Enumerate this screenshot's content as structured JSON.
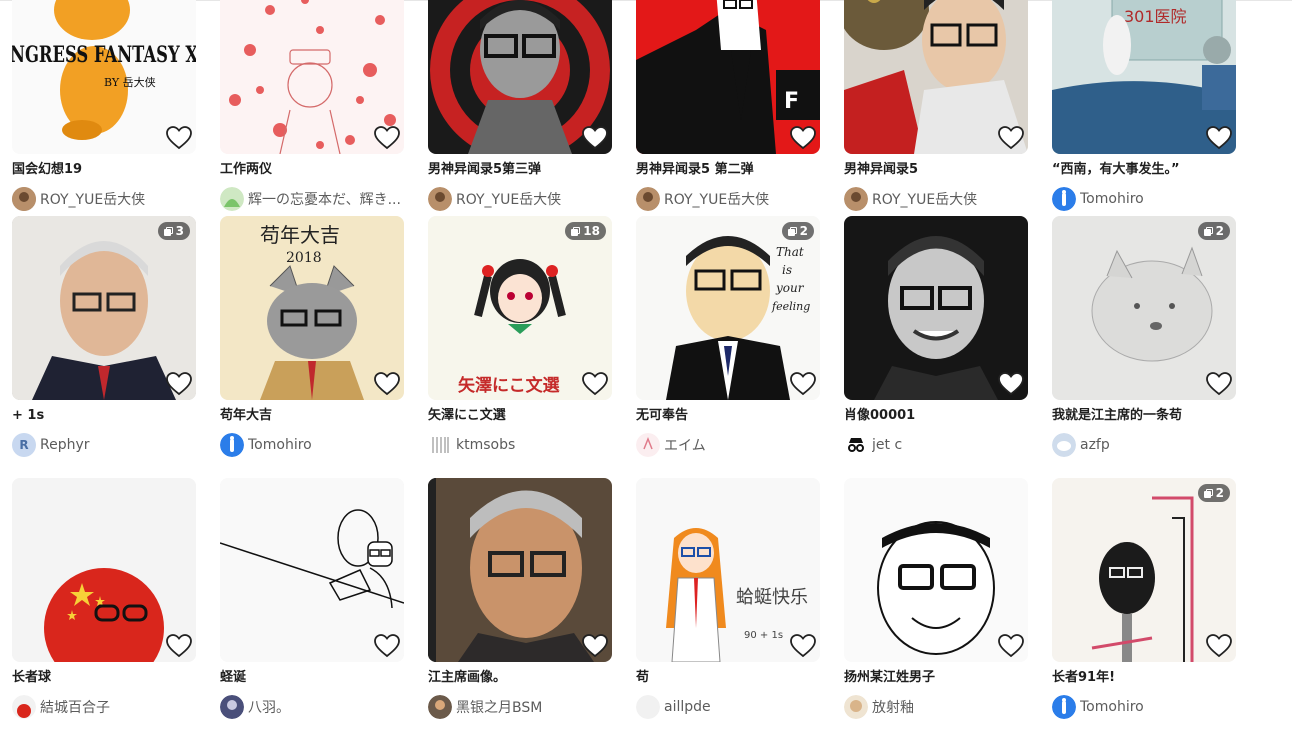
{
  "rows": [
    [
      {
        "title": "国会幻想19",
        "user": "ROY_YUE岳大侠",
        "badge": null,
        "art_text": "NGRESS FANTASY X",
        "art_sub": "BY 岳大侠"
      },
      {
        "title": "工作两仪",
        "user": "辉一の忘憂本だ、辉き...",
        "badge": null
      },
      {
        "title": "男神异闻录5第三弹",
        "user": "ROY_YUE岳大侠",
        "badge": null
      },
      {
        "title": "男神异闻录5 第二弹",
        "user": "ROY_YUE岳大侠",
        "badge": null
      },
      {
        "title": "男神异闻录5",
        "user": "ROY_YUE岳大侠",
        "badge": null
      },
      {
        "title": "“西南，有大事发生。”",
        "user": "Tomohiro",
        "badge": null,
        "art_text": "301医院"
      }
    ],
    [
      {
        "title": "+ 1s",
        "user": "Rephyr",
        "badge": "3"
      },
      {
        "title": "苟年大吉",
        "user": "Tomohiro",
        "badge": null,
        "art_text": "苟年大吉",
        "art_sub": "2018"
      },
      {
        "title": "矢澤にこ文選",
        "user": "ktmsobs",
        "badge": "18",
        "art_text": "矢澤にこ文選"
      },
      {
        "title": "无可奉告",
        "user": "エイム",
        "badge": "2",
        "art_text": "That is your feeling"
      },
      {
        "title": "肖像00001",
        "user": "jet c",
        "badge": null
      },
      {
        "title": "我就是江主席的一条苟",
        "user": "azfp",
        "badge": "2"
      }
    ],
    [
      {
        "title": "长者球",
        "user": "結城百合子",
        "badge": null
      },
      {
        "title": "蛏诞",
        "user": "八羽。",
        "badge": null
      },
      {
        "title": "江主席画像。",
        "user": "黑银之月BSM",
        "badge": null
      },
      {
        "title": "苟",
        "user": "aillpde",
        "badge": null,
        "art_text": "蛤蜓快乐"
      },
      {
        "title": "扬州某江姓男子",
        "user": "放射釉",
        "badge": null
      },
      {
        "title": "长者91年!",
        "user": "Tomohiro",
        "badge": "2"
      }
    ]
  ],
  "avatar_letters": {
    "rephyr": "R"
  },
  "colors": {
    "accent": "#2b7de9",
    "badge_bg": "#3c3c3c",
    "heart": "#ffffff"
  },
  "icons": {
    "heart": "heart-icon",
    "pages": "pages-icon"
  }
}
